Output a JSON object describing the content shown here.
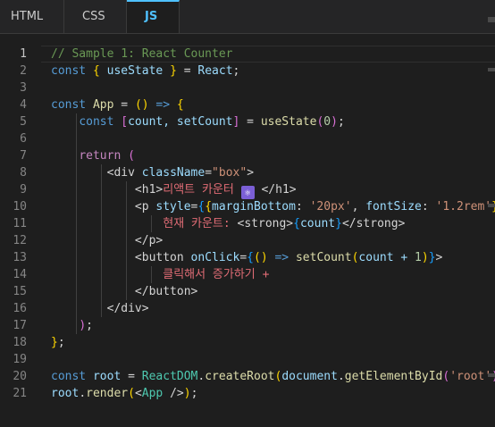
{
  "tabs": [
    {
      "label": "HTML"
    },
    {
      "label": "CSS"
    },
    {
      "label": "JS"
    }
  ],
  "icons": {
    "atom": "atom-icon"
  },
  "lines": [
    {
      "n": "1",
      "tokens": [
        [
          "// Sample 1: React Counter",
          "t-comment"
        ]
      ]
    },
    {
      "n": "2",
      "tokens": [
        [
          "const ",
          "t-key"
        ],
        [
          "{",
          "t-br1"
        ],
        [
          " useState ",
          "t-var"
        ],
        [
          "}",
          "t-br1"
        ],
        [
          " = ",
          "t-plain"
        ],
        [
          "React",
          "t-var"
        ],
        [
          ";",
          "t-plain"
        ]
      ]
    },
    {
      "n": "3",
      "tokens": []
    },
    {
      "n": "4",
      "tokens": [
        [
          "const ",
          "t-key"
        ],
        [
          "App",
          "t-fn"
        ],
        [
          " = ",
          "t-plain"
        ],
        [
          "()",
          "t-br1"
        ],
        [
          " => ",
          "t-key"
        ],
        [
          "{",
          "t-br1"
        ]
      ]
    },
    {
      "n": "5",
      "tokens": [
        [
          "    ",
          "t-plain"
        ],
        [
          "const ",
          "t-key"
        ],
        [
          "[",
          "t-br2"
        ],
        [
          "count, setCount",
          "t-var"
        ],
        [
          "]",
          "t-br2"
        ],
        [
          " = ",
          "t-plain"
        ],
        [
          "useState",
          "t-fn"
        ],
        [
          "(",
          "t-br2"
        ],
        [
          "0",
          "t-num"
        ],
        [
          ")",
          "t-br2"
        ],
        [
          ";",
          "t-plain"
        ]
      ]
    },
    {
      "n": "6",
      "tokens": []
    },
    {
      "n": "7",
      "tokens": [
        [
          "    ",
          "t-plain"
        ],
        [
          "return ",
          "t-ctl"
        ],
        [
          "(",
          "t-br2"
        ]
      ]
    },
    {
      "n": "8",
      "tokens": [
        [
          "        ",
          "t-plain"
        ],
        [
          "<div ",
          "t-tag"
        ],
        [
          "className",
          "t-attr"
        ],
        [
          "=",
          "t-plain"
        ],
        [
          "\"box\"",
          "t-str"
        ],
        [
          ">",
          "t-tag"
        ]
      ]
    },
    {
      "n": "9",
      "tokens": [
        [
          "            ",
          "t-plain"
        ],
        [
          "<h1>",
          "t-tag"
        ],
        [
          "리액트 카운터 ",
          "t-text"
        ],
        [
          "⚛",
          "t-emoji"
        ],
        [
          " </h1>",
          "t-tag"
        ]
      ]
    },
    {
      "n": "10",
      "tokens": [
        [
          "            ",
          "t-plain"
        ],
        [
          "<p ",
          "t-tag"
        ],
        [
          "style",
          "t-attr"
        ],
        [
          "=",
          "t-plain"
        ],
        [
          "{",
          "t-br3"
        ],
        [
          "{",
          "t-br1"
        ],
        [
          "marginBottom",
          "t-var"
        ],
        [
          ": ",
          "t-plain"
        ],
        [
          "'20px'",
          "t-str"
        ],
        [
          ", ",
          "t-plain"
        ],
        [
          "fontSize",
          "t-var"
        ],
        [
          ": ",
          "t-plain"
        ],
        [
          "'1.2rem'",
          "t-str"
        ],
        [
          "}",
          "t-br1"
        ],
        [
          "}",
          "t-br3"
        ],
        [
          ">",
          "t-tag"
        ]
      ]
    },
    {
      "n": "11",
      "tokens": [
        [
          "                ",
          "t-plain"
        ],
        [
          "현재 카운트: ",
          "t-text"
        ],
        [
          "<strong>",
          "t-tag"
        ],
        [
          "{",
          "t-br3"
        ],
        [
          "count",
          "t-var"
        ],
        [
          "}",
          "t-br3"
        ],
        [
          "</strong>",
          "t-tag"
        ]
      ]
    },
    {
      "n": "12",
      "tokens": [
        [
          "            ",
          "t-plain"
        ],
        [
          "</p>",
          "t-tag"
        ]
      ]
    },
    {
      "n": "13",
      "tokens": [
        [
          "            ",
          "t-plain"
        ],
        [
          "<button ",
          "t-tag"
        ],
        [
          "onClick",
          "t-attr"
        ],
        [
          "=",
          "t-plain"
        ],
        [
          "{",
          "t-br3"
        ],
        [
          "()",
          "t-br1"
        ],
        [
          " => ",
          "t-key"
        ],
        [
          "setCount",
          "t-fn"
        ],
        [
          "(",
          "t-br1"
        ],
        [
          "count + ",
          "t-var"
        ],
        [
          "1",
          "t-num"
        ],
        [
          ")",
          "t-br1"
        ],
        [
          "}",
          "t-br3"
        ],
        [
          ">",
          "t-tag"
        ]
      ]
    },
    {
      "n": "14",
      "tokens": [
        [
          "                ",
          "t-plain"
        ],
        [
          "클릭해서 증가하기 +",
          "t-text"
        ]
      ]
    },
    {
      "n": "15",
      "tokens": [
        [
          "            ",
          "t-plain"
        ],
        [
          "</button>",
          "t-tag"
        ]
      ]
    },
    {
      "n": "16",
      "tokens": [
        [
          "        ",
          "t-plain"
        ],
        [
          "</div>",
          "t-tag"
        ]
      ]
    },
    {
      "n": "17",
      "tokens": [
        [
          "    ",
          "t-plain"
        ],
        [
          ")",
          "t-br2"
        ],
        [
          ";",
          "t-plain"
        ]
      ]
    },
    {
      "n": "18",
      "tokens": [
        [
          "}",
          "t-br1"
        ],
        [
          ";",
          "t-plain"
        ]
      ]
    },
    {
      "n": "19",
      "tokens": []
    },
    {
      "n": "20",
      "tokens": [
        [
          "const ",
          "t-key"
        ],
        [
          "root",
          "t-var"
        ],
        [
          " = ",
          "t-plain"
        ],
        [
          "ReactDOM",
          "t-cls"
        ],
        [
          ".",
          "t-plain"
        ],
        [
          "createRoot",
          "t-fn"
        ],
        [
          "(",
          "t-br1"
        ],
        [
          "document",
          "t-var"
        ],
        [
          ".",
          "t-plain"
        ],
        [
          "getElementById",
          "t-fn"
        ],
        [
          "(",
          "t-br2"
        ],
        [
          "'root'",
          "t-str"
        ],
        [
          ")",
          "t-br2"
        ],
        [
          ")",
          "t-br1"
        ],
        [
          ";",
          "t-plain"
        ]
      ]
    },
    {
      "n": "21",
      "tokens": [
        [
          "root",
          "t-var"
        ],
        [
          ".",
          "t-plain"
        ],
        [
          "render",
          "t-fn"
        ],
        [
          "(",
          "t-br1"
        ],
        [
          "<",
          "t-tag"
        ],
        [
          "App",
          "t-cls"
        ],
        [
          " />",
          "t-tag"
        ],
        [
          ")",
          "t-br1"
        ],
        [
          ";",
          "t-plain"
        ]
      ]
    }
  ]
}
